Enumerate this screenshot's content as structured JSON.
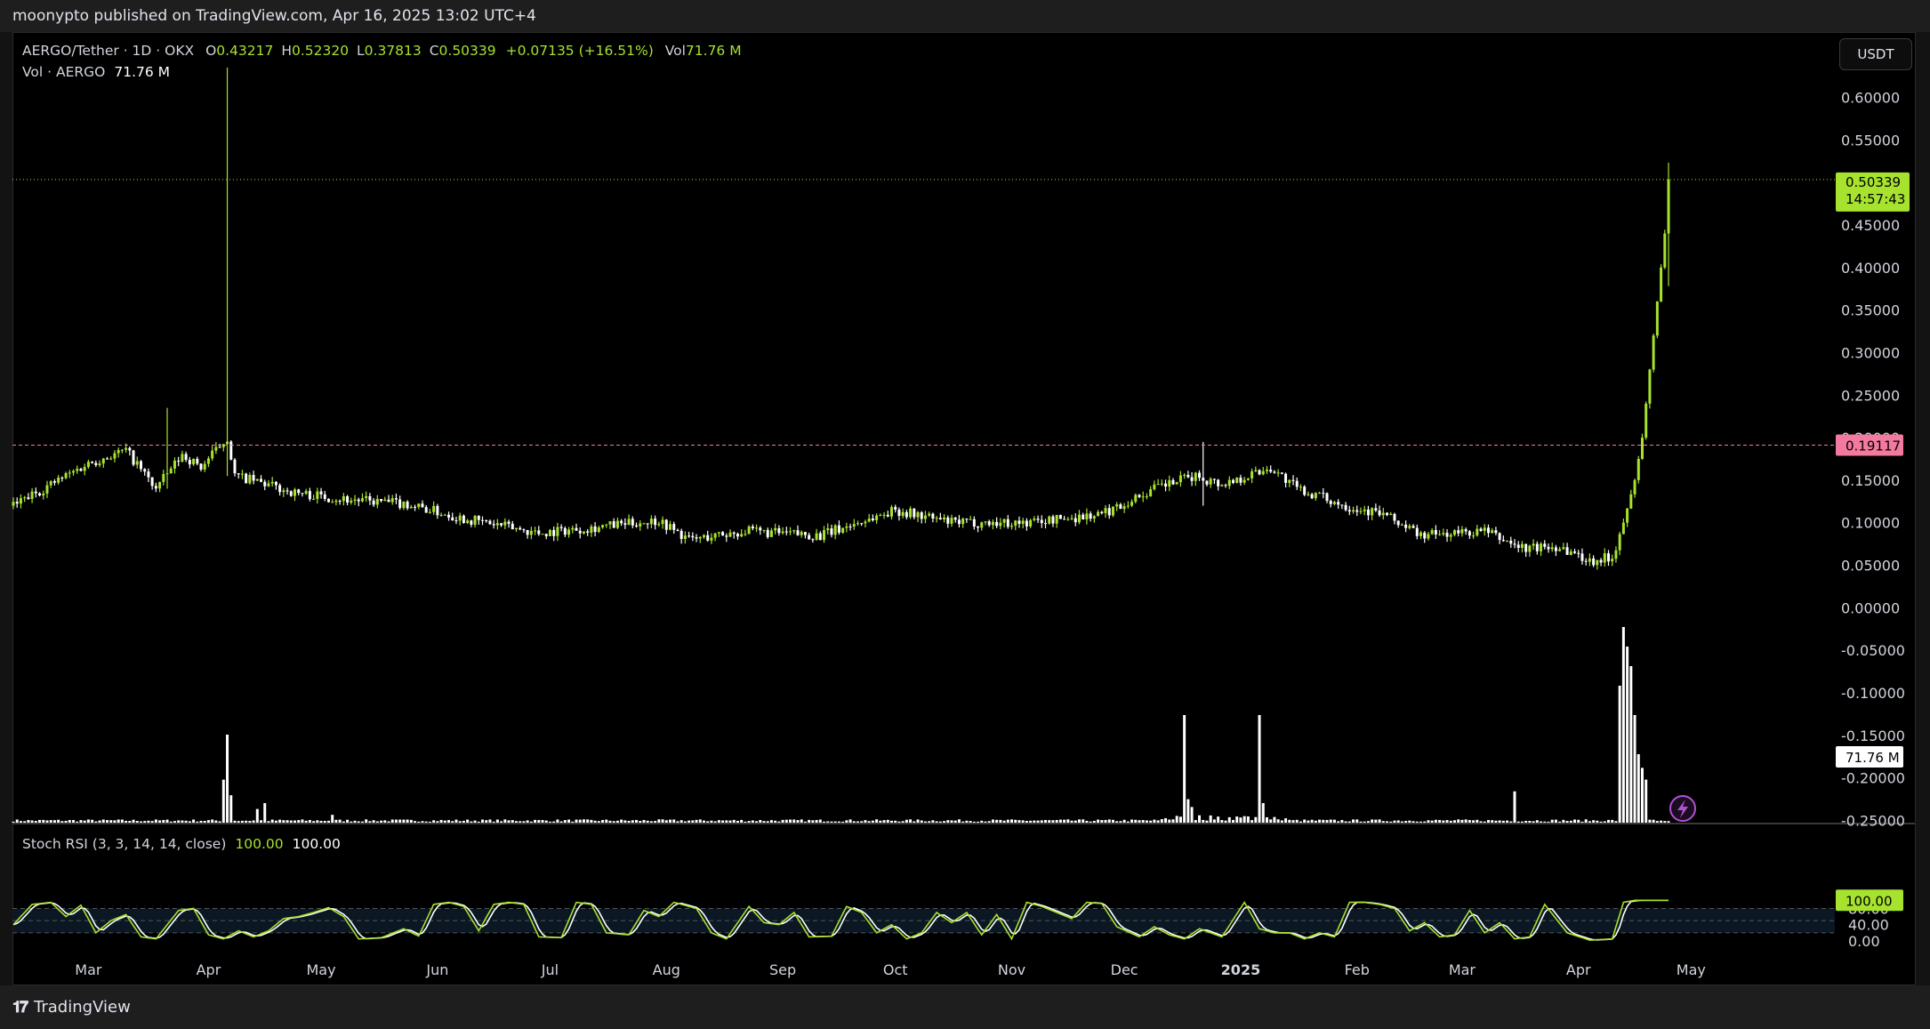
{
  "header": {
    "published": "moonypto published on TradingView.com, Apr 16, 2025 13:02 UTC+4"
  },
  "legend": {
    "symbol": "AERGO/Tether · 1D · OKX",
    "o_label": "O",
    "o": "0.43217",
    "h_label": "H",
    "h": "0.52320",
    "l_label": "L",
    "l": "0.37813",
    "c_label": "C",
    "c": "0.50339",
    "change": "+0.07135 (+16.51%)",
    "vol_label": "Vol",
    "vol": "71.76 M",
    "vol_line_label": "Vol · AERGO",
    "vol_line_value": "71.76 M"
  },
  "currency_button": "USDT",
  "rsi_legend": {
    "label": "Stoch RSI (3, 3, 14, 14, close)",
    "k": "100.00",
    "d": "100.00"
  },
  "footer": {
    "brand": "TradingView"
  },
  "colors": {
    "up": "#a6e22e",
    "down": "#ffffff",
    "background": "#000000",
    "level_line": "#f27a9f"
  },
  "chart_data": [
    {
      "type": "candlestick",
      "symbol": "AERGO/Tether",
      "interval": "1D",
      "exchange": "OKX",
      "y_ticks": [
        "0.60000",
        "0.55000",
        "0.50000",
        "0.45000",
        "0.40000",
        "0.35000",
        "0.30000",
        "0.25000",
        "0.20000",
        "0.15000",
        "0.10000",
        "0.05000",
        "0.00000",
        "-0.05000",
        "-0.10000",
        "-0.15000",
        "-0.20000",
        "-0.25000"
      ],
      "ylim": [
        -0.27,
        0.63
      ],
      "x_ticks": [
        "Mar",
        "Apr",
        "May",
        "Jun",
        "Jul",
        "Aug",
        "Sep",
        "Oct",
        "Nov",
        "Dec",
        "2025",
        "Feb",
        "Mar",
        "Apr",
        "May"
      ],
      "x_tick_day_index": [
        20,
        52,
        82,
        113,
        143,
        174,
        205,
        235,
        266,
        296,
        327,
        358,
        386,
        417,
        447
      ],
      "total_days": 484,
      "last_price": 0.50339,
      "last_price_label": "0.50339",
      "countdown_label": "14:57:43",
      "level_price": 0.19117,
      "level_label": "0.19117",
      "volume_label": "71.76 M",
      "close_anchors": [
        [
          0,
          0.12
        ],
        [
          20,
          0.17
        ],
        [
          30,
          0.185
        ],
        [
          38,
          0.14
        ],
        [
          45,
          0.18
        ],
        [
          50,
          0.165
        ],
        [
          57,
          0.2
        ],
        [
          59,
          0.155
        ],
        [
          65,
          0.148
        ],
        [
          75,
          0.135
        ],
        [
          90,
          0.127
        ],
        [
          105,
          0.122
        ],
        [
          120,
          0.105
        ],
        [
          140,
          0.088
        ],
        [
          160,
          0.097
        ],
        [
          172,
          0.103
        ],
        [
          180,
          0.08
        ],
        [
          195,
          0.09
        ],
        [
          215,
          0.085
        ],
        [
          235,
          0.115
        ],
        [
          250,
          0.1
        ],
        [
          270,
          0.1
        ],
        [
          290,
          0.11
        ],
        [
          305,
          0.142
        ],
        [
          315,
          0.155
        ],
        [
          322,
          0.145
        ],
        [
          335,
          0.165
        ],
        [
          342,
          0.14
        ],
        [
          355,
          0.12
        ],
        [
          365,
          0.11
        ],
        [
          375,
          0.085
        ],
        [
          392,
          0.09
        ],
        [
          402,
          0.07
        ],
        [
          412,
          0.072
        ],
        [
          420,
          0.055
        ],
        [
          426,
          0.06
        ],
        [
          429,
          0.1
        ],
        [
          432,
          0.15
        ],
        [
          434,
          0.2
        ],
        [
          436,
          0.28
        ],
        [
          438,
          0.36
        ],
        [
          440,
          0.44
        ],
        [
          441,
          0.50339
        ]
      ],
      "special_candles": [
        {
          "day": 57,
          "high": 0.635,
          "low": 0.155
        },
        {
          "day": 41,
          "high": 0.235,
          "low": 0.14
        },
        {
          "day": 317,
          "high": 0.195,
          "low": 0.12
        }
      ],
      "volume_spikes": [
        [
          56,
          0.22
        ],
        [
          57,
          0.45
        ],
        [
          58,
          0.14
        ],
        [
          65,
          0.07
        ],
        [
          67,
          0.1
        ],
        [
          85,
          0.04
        ],
        [
          312,
          0.55
        ],
        [
          313,
          0.12
        ],
        [
          314,
          0.08
        ],
        [
          332,
          0.55
        ],
        [
          333,
          0.1
        ],
        [
          400,
          0.16
        ],
        [
          428,
          0.7
        ],
        [
          429,
          1.0
        ],
        [
          430,
          0.9
        ],
        [
          431,
          0.8
        ],
        [
          432,
          0.55
        ],
        [
          433,
          0.35
        ],
        [
          434,
          0.28
        ],
        [
          435,
          0.22
        ]
      ]
    },
    {
      "type": "line",
      "name": "Stoch RSI (3, 3, 14, 14, close)",
      "y_ticks": [
        "80.00",
        "40.00",
        "0.00"
      ],
      "ylim": [
        -5,
        105
      ],
      "band": [
        20,
        80
      ],
      "last_value_label": "100.00",
      "k_anchors": [
        [
          0,
          40
        ],
        [
          5,
          90
        ],
        [
          10,
          95
        ],
        [
          14,
          60
        ],
        [
          18,
          88
        ],
        [
          22,
          20
        ],
        [
          26,
          50
        ],
        [
          30,
          65
        ],
        [
          34,
          10
        ],
        [
          38,
          5
        ],
        [
          44,
          75
        ],
        [
          48,
          80
        ],
        [
          52,
          15
        ],
        [
          56,
          5
        ],
        [
          60,
          25
        ],
        [
          64,
          10
        ],
        [
          68,
          25
        ],
        [
          72,
          55
        ],
        [
          76,
          60
        ],
        [
          80,
          70
        ],
        [
          84,
          82
        ],
        [
          88,
          60
        ],
        [
          92,
          5
        ],
        [
          98,
          8
        ],
        [
          104,
          30
        ],
        [
          108,
          12
        ],
        [
          112,
          90
        ],
        [
          116,
          95
        ],
        [
          120,
          85
        ],
        [
          124,
          25
        ],
        [
          128,
          90
        ],
        [
          132,
          95
        ],
        [
          136,
          90
        ],
        [
          140,
          10
        ],
        [
          146,
          8
        ],
        [
          150,
          95
        ],
        [
          154,
          90
        ],
        [
          158,
          20
        ],
        [
          164,
          15
        ],
        [
          168,
          75
        ],
        [
          172,
          60
        ],
        [
          176,
          95
        ],
        [
          182,
          80
        ],
        [
          186,
          20
        ],
        [
          190,
          5
        ],
        [
          196,
          85
        ],
        [
          200,
          45
        ],
        [
          204,
          40
        ],
        [
          208,
          70
        ],
        [
          212,
          10
        ],
        [
          218,
          12
        ],
        [
          222,
          85
        ],
        [
          226,
          70
        ],
        [
          230,
          20
        ],
        [
          234,
          40
        ],
        [
          238,
          5
        ],
        [
          242,
          20
        ],
        [
          246,
          70
        ],
        [
          250,
          45
        ],
        [
          254,
          70
        ],
        [
          258,
          15
        ],
        [
          262,
          65
        ],
        [
          266,
          5
        ],
        [
          270,
          95
        ],
        [
          274,
          85
        ],
        [
          278,
          70
        ],
        [
          282,
          55
        ],
        [
          286,
          95
        ],
        [
          290,
          92
        ],
        [
          294,
          35
        ],
        [
          300,
          10
        ],
        [
          304,
          35
        ],
        [
          308,
          15
        ],
        [
          312,
          5
        ],
        [
          316,
          30
        ],
        [
          322,
          10
        ],
        [
          328,
          95
        ],
        [
          332,
          30
        ],
        [
          336,
          20
        ],
        [
          340,
          20
        ],
        [
          344,
          5
        ],
        [
          348,
          20
        ],
        [
          352,
          10
        ],
        [
          356,
          95
        ],
        [
          360,
          95
        ],
        [
          364,
          90
        ],
        [
          368,
          80
        ],
        [
          372,
          25
        ],
        [
          376,
          45
        ],
        [
          380,
          10
        ],
        [
          384,
          15
        ],
        [
          388,
          75
        ],
        [
          392,
          20
        ],
        [
          396,
          45
        ],
        [
          400,
          5
        ],
        [
          404,
          10
        ],
        [
          408,
          90
        ],
        [
          414,
          20
        ],
        [
          420,
          2
        ],
        [
          426,
          5
        ],
        [
          429,
          95
        ],
        [
          432,
          100
        ],
        [
          441,
          100
        ]
      ]
    }
  ]
}
